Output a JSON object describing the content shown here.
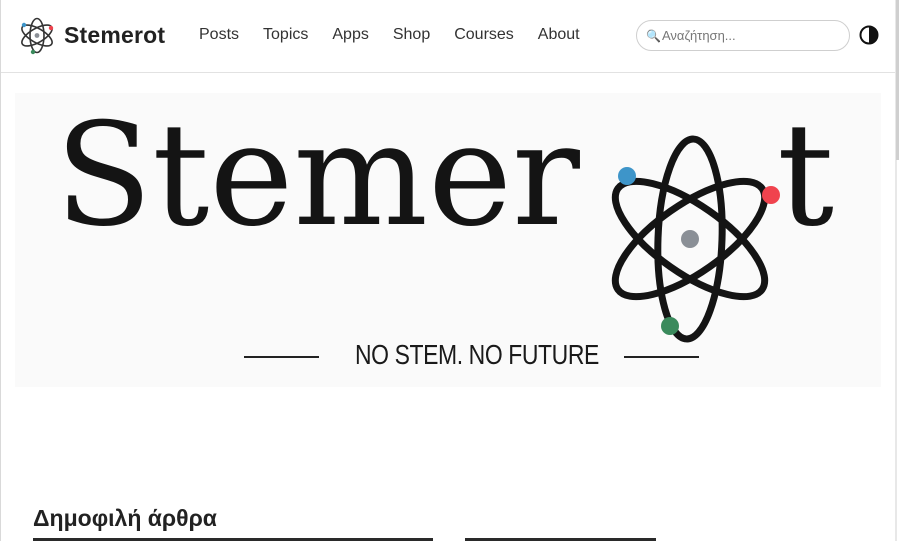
{
  "brand": {
    "name": "Stemerot",
    "logo_icon": "atom-icon"
  },
  "nav": {
    "items": [
      {
        "label": "Posts"
      },
      {
        "label": "Topics"
      },
      {
        "label": "Apps"
      },
      {
        "label": "Shop"
      },
      {
        "label": "Courses"
      },
      {
        "label": "About"
      }
    ]
  },
  "search": {
    "placeholder": "Αναζήτηση...",
    "icon": "magnifier-icon"
  },
  "theme_toggle": {
    "icon": "half-circle-contrast-icon"
  },
  "hero": {
    "title_main": "Stemer",
    "title_end": "t",
    "tagline": "NO STEM. NO FUTURE",
    "atom_colors": {
      "blue": "#3e95c9",
      "red": "#f0434e",
      "green": "#3a8a5c",
      "nucleus": "#8a8f96"
    }
  },
  "popular": {
    "title": "Δημοφιλή άρθρα"
  }
}
